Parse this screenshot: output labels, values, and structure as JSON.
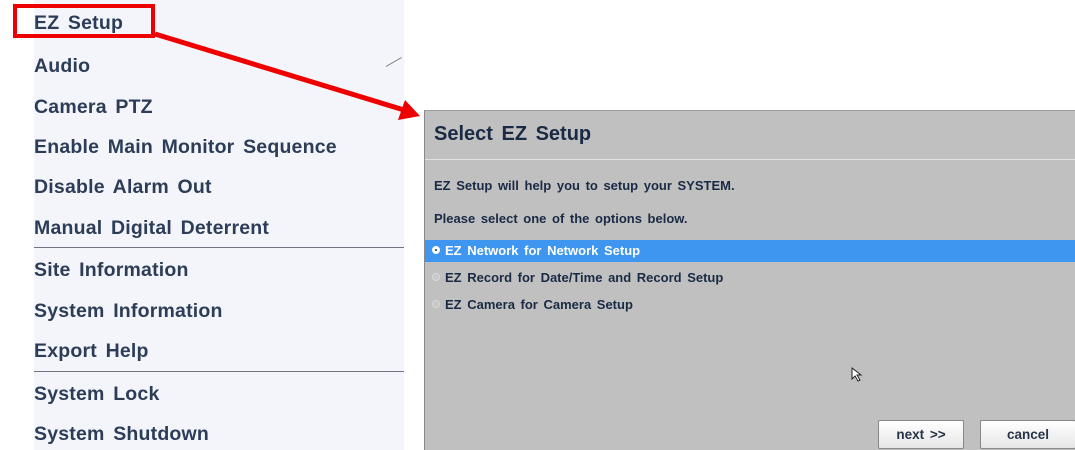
{
  "menu": {
    "items": [
      {
        "label": "EZ Setup"
      },
      {
        "label": "Audio"
      },
      {
        "label": "Camera PTZ"
      },
      {
        "label": "Enable Main Monitor Sequence"
      },
      {
        "label": "Disable Alarm Out"
      },
      {
        "label": "Manual Digital Deterrent"
      },
      {
        "label": "Site Information"
      },
      {
        "label": "System Information"
      },
      {
        "label": "Export Help"
      },
      {
        "label": "System Lock"
      },
      {
        "label": "System Shutdown"
      }
    ]
  },
  "dialog": {
    "title": "Select EZ Setup",
    "intro": "EZ Setup will help you to setup your SYSTEM.",
    "instruction": "Please select one of the options below.",
    "options": [
      {
        "label": "EZ Network for Network Setup",
        "selected": true
      },
      {
        "label": "EZ Record for Date/Time and Record Setup",
        "selected": false
      },
      {
        "label": "EZ Camera for Camera Setup",
        "selected": false
      }
    ],
    "next_label": "next >>",
    "cancel_label": "cancel"
  },
  "colors": {
    "highlight": "#ef0000",
    "selected_option": "#3f96f0",
    "dialog_bg": "#c0c0c0",
    "menu_text": "#2d3d57"
  }
}
